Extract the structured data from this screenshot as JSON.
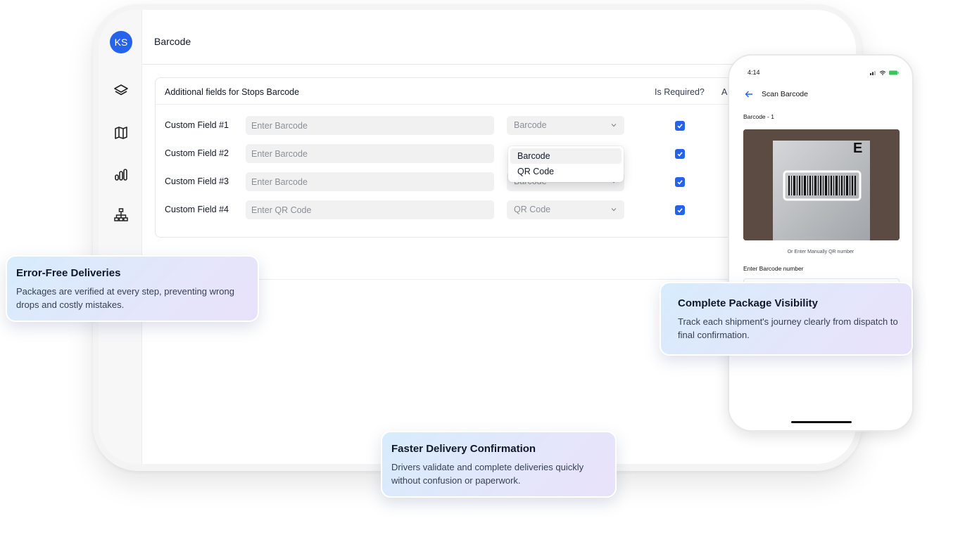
{
  "app": {
    "avatar_initials": "KS",
    "page_title": "Barcode",
    "accent_color": "#2563eb"
  },
  "sidebar": {
    "items": [
      {
        "icon": "layers-icon"
      },
      {
        "icon": "map-icon"
      },
      {
        "icon": "analytics-icon"
      },
      {
        "icon": "hierarchy-icon"
      }
    ]
  },
  "card": {
    "title": "Additional fields for Stops Barcode",
    "columns": {
      "required": "Is Required?",
      "truncated": "A"
    },
    "rows": [
      {
        "label": "Custom Field #1",
        "placeholder": "Enter Barcode",
        "type": "Barcode",
        "required": true
      },
      {
        "label": "Custom Field #2",
        "placeholder": "Enter Barcode",
        "type": "Barcode",
        "required": true
      },
      {
        "label": "Custom Field #3",
        "placeholder": "Enter Barcode",
        "type": "Barcode",
        "required": true
      },
      {
        "label": "Custom Field #4",
        "placeholder": "Enter QR Code",
        "type": "QR Code",
        "required": true
      }
    ],
    "dropdown_options": [
      "Barcode",
      "QR Code"
    ],
    "dropdown_selected": "Barcode"
  },
  "phone": {
    "time": "4:14",
    "title": "Scan Barcode",
    "barcode_label": "Barcode - 1",
    "label_letter": "E",
    "manual_hint": "Or Enter Manually QR number",
    "input_label": "Enter Barcode number"
  },
  "callouts": {
    "error_free": {
      "title": "Error-Free Deliveries",
      "body": "Packages are verified at every step, preventing wrong drops and costly mistakes."
    },
    "visibility": {
      "title": "Complete Package Visibility",
      "body": "Track each shipment's journey clearly from dispatch to final confirmation."
    },
    "faster": {
      "title": "Faster Delivery Confirmation",
      "body": "Drivers validate and complete deliveries quickly without confusion or paperwork."
    }
  }
}
